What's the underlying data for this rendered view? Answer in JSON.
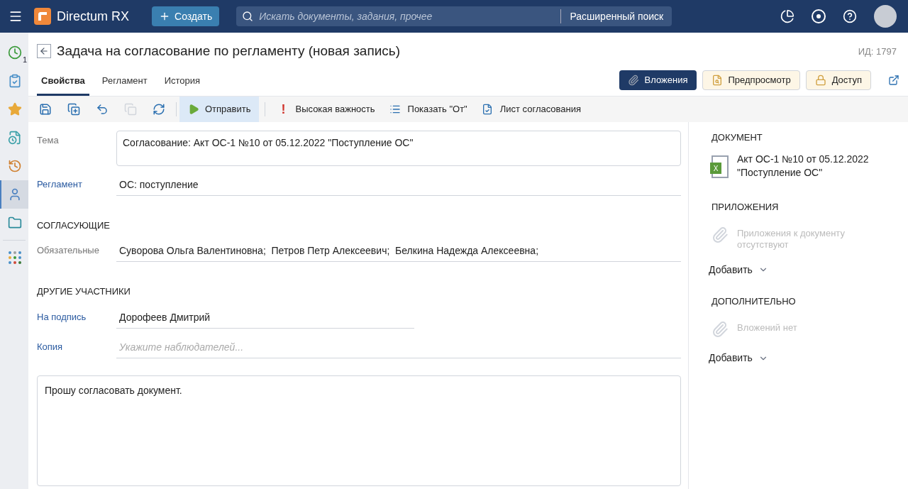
{
  "header": {
    "app_name": "Directum RX",
    "create_button": "Создать",
    "search": {
      "placeholder": "Искать документы, задания, прочее"
    },
    "advanced_search": "Расширенный поиск"
  },
  "sidebar": {
    "items": [
      {
        "selected": false,
        "badge": "1"
      },
      {
        "selected": false
      },
      {
        "selected": false
      },
      {
        "selected": false
      },
      {
        "selected": false
      },
      {
        "selected": true
      },
      {
        "selected": false
      },
      {
        "selected": false
      }
    ]
  },
  "title": "Задача на согласование по регламенту (новая запись)",
  "record_id": "ИД: 1797",
  "tabs": [
    {
      "label": "Свойства",
      "selected": true
    },
    {
      "label": "Регламент",
      "selected": false
    },
    {
      "label": "История",
      "selected": false
    }
  ],
  "actions": [
    {
      "kind": "dark",
      "label": "Вложения"
    },
    {
      "kind": "light",
      "label": "Предпросмотр"
    },
    {
      "kind": "light",
      "label": "Доступ"
    }
  ],
  "toolbar": [
    {
      "kind": "icon",
      "disabled": false
    },
    {
      "kind": "icon",
      "disabled": false
    },
    {
      "kind": "icon",
      "disabled": false
    },
    {
      "kind": "icon",
      "disabled": true
    },
    {
      "kind": "icon",
      "disabled": false
    },
    {
      "kind": "primary",
      "label": "Отправить"
    },
    {
      "kind": "text",
      "mark": "!",
      "label": "Высокая важность"
    },
    {
      "kind": "text",
      "label": "Показать \"От\""
    },
    {
      "kind": "text",
      "label": "Лист согласования"
    }
  ],
  "form": [
    {
      "kind": "textarea",
      "label": "Тема",
      "link": false,
      "value": "Согласование: Акт ОС-1 №10 от 05.12.2022 \"Поступление ОС\""
    },
    {
      "kind": "field",
      "label": "Регламент",
      "link": true,
      "value": "ОС: поступление"
    },
    {
      "kind": "heading",
      "label": "СОГЛАСУЮЩИЕ"
    },
    {
      "kind": "field",
      "label": "Обязательные",
      "link": false,
      "value": "Суворова Ольга Валентиновна;  Петров Петр Алексеевич;  Белкина Надежда Алексеевна;"
    },
    {
      "kind": "heading",
      "label": "ДРУГИЕ УЧАСТНИКИ"
    },
    {
      "kind": "short",
      "label": "На подпись",
      "link": true,
      "value": "Дорофеев Дмитрий"
    },
    {
      "kind": "field",
      "label": "Копия",
      "link": true,
      "placeholder": "Укажите наблюдателей..."
    }
  ],
  "comment": "Прошу согласовать документ.",
  "right_panel": {
    "document": {
      "heading": "ДОКУМЕНТ",
      "file_badge": "X",
      "name": "Акт ОС-1 №10 от 05.12.2022 \"Поступление ОС\""
    },
    "sections": [
      {
        "heading": "ПРИЛОЖЕНИЯ",
        "empty": "Приложения к документу отсутствуют",
        "add": "Добавить"
      },
      {
        "heading": "ДОПОЛНИТЕЛЬНО",
        "empty": "Вложений нет",
        "add": "Добавить"
      }
    ]
  }
}
